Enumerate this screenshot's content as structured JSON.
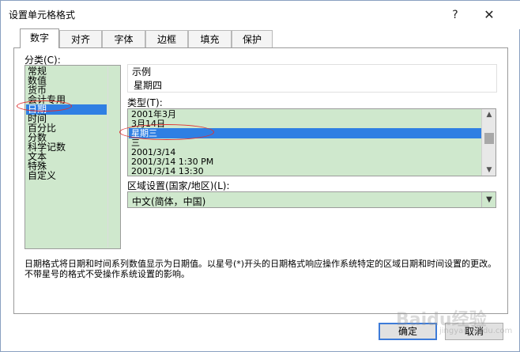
{
  "title": "设置单元格格式",
  "title_buttons": {
    "help": "?",
    "close": "✕"
  },
  "tabs": [
    {
      "label": "数字",
      "active": true
    },
    {
      "label": "对齐",
      "active": false
    },
    {
      "label": "字体",
      "active": false
    },
    {
      "label": "边框",
      "active": false
    },
    {
      "label": "填充",
      "active": false
    },
    {
      "label": "保护",
      "active": false
    }
  ],
  "category": {
    "label": "分类(C):",
    "items": [
      "常规",
      "数值",
      "货币",
      "会计专用",
      "日期",
      "时间",
      "百分比",
      "分数",
      "科学记数",
      "文本",
      "特殊",
      "自定义"
    ],
    "selected": "日期"
  },
  "sample": {
    "label": "示例",
    "value": "星期四"
  },
  "type": {
    "label": "类型(T):",
    "items": [
      "2001年3月",
      "3月14日",
      "星期三",
      "三",
      "2001/3/14",
      "2001/3/14 1:30 PM",
      "2001/3/14 13:30"
    ],
    "selected": "星期三"
  },
  "locale": {
    "label": "区域设置(国家/地区)(L):",
    "value": "中文(简体，中国)"
  },
  "description": "日期格式将日期和时间系列数值显示为日期值。以星号(*)开头的日期格式响应操作系统特定的区域日期和时间设置的更改。不带星号的格式不受操作系统设置的影响。",
  "buttons": {
    "ok": "确定",
    "cancel": "取消"
  },
  "watermark": "Baidu经验",
  "watermark_sub": "jingyan.baidu.com",
  "colors": {
    "list_bg": "#cfe8cd",
    "selection": "#2f7fe3",
    "annotation": "#e03030"
  }
}
